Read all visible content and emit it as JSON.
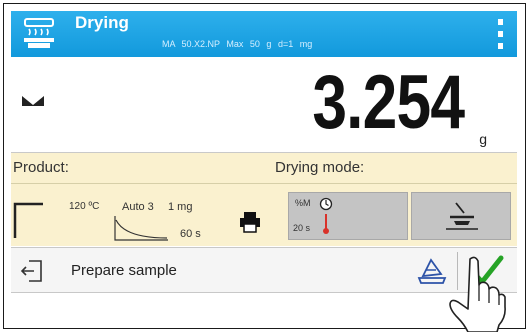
{
  "header": {
    "title": "Drying",
    "model": "MA 50.X2.NP",
    "max": "Max 50 g",
    "d": "d=1 mg",
    "color": "#1aa2e2"
  },
  "display": {
    "weight": "3.254",
    "unit": "g"
  },
  "info": {
    "product_label": "Product:",
    "drying_mode_label": "Drying mode:"
  },
  "status": {
    "temperature": "120 ºC",
    "mode": "Auto 3",
    "threshold": "1 mg",
    "interval": "60 s",
    "result_unit": "%M",
    "print_interval": "20 s"
  },
  "bottom": {
    "prompt": "Prepare sample"
  },
  "accent": {
    "ok": "#26a326",
    "thermo": "#d9322a"
  }
}
